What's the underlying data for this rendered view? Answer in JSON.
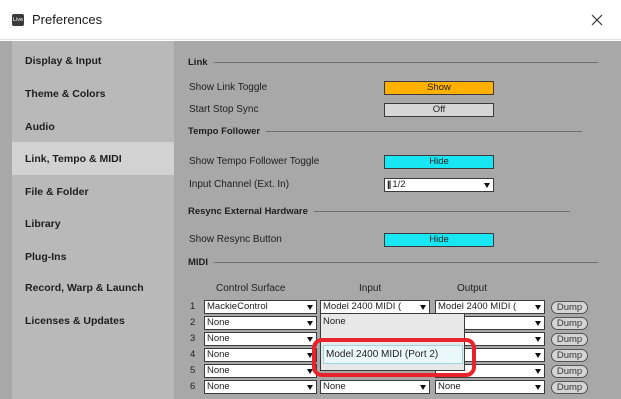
{
  "window": {
    "app_icon_text": "Live",
    "title": "Preferences"
  },
  "sidebar": {
    "items": [
      {
        "label": "Display & Input",
        "active": false
      },
      {
        "label": "Theme & Colors",
        "active": false
      },
      {
        "label": "Audio",
        "active": false
      },
      {
        "label": "Link, Tempo & MIDI",
        "active": true
      },
      {
        "label": "File & Folder",
        "active": false
      },
      {
        "label": "Library",
        "active": false
      },
      {
        "label": "Plug-Ins",
        "active": false
      },
      {
        "label": "Record, Warp & Launch",
        "active": false
      },
      {
        "label": "Licenses & Updates",
        "active": false
      }
    ]
  },
  "link": {
    "section": "Link",
    "show_toggle_label": "Show Link Toggle",
    "show_toggle_value": "Show",
    "start_stop_label": "Start Stop Sync",
    "start_stop_value": "Off"
  },
  "tempo_follower": {
    "section": "Tempo Follower",
    "show_toggle_label": "Show Tempo Follower Toggle",
    "show_toggle_value": "Hide",
    "input_channel_label": "Input Channel (Ext. In)",
    "input_channel_value": "1/2"
  },
  "resync": {
    "section": "Resync External Hardware",
    "show_button_label": "Show Resync Button",
    "show_button_value": "Hide"
  },
  "midi": {
    "section": "MIDI",
    "headers": {
      "control_surface": "Control Surface",
      "input": "Input",
      "output": "Output"
    },
    "dump_label": "Dump",
    "rows": [
      {
        "num": "1",
        "surface": "MackieControl",
        "input": "Model 2400 MIDI (",
        "output": "Model 2400 MIDI ("
      },
      {
        "num": "2",
        "surface": "None",
        "input": "",
        "output": ""
      },
      {
        "num": "3",
        "surface": "None",
        "input": "",
        "output": ""
      },
      {
        "num": "4",
        "surface": "None",
        "input": "",
        "output": ""
      },
      {
        "num": "5",
        "surface": "None",
        "input": "",
        "output": ""
      },
      {
        "num": "6",
        "surface": "None",
        "input": "None",
        "output": "None"
      }
    ],
    "dropdown": {
      "option_none": "None",
      "highlighted": "Model 2400 MIDI (Port 2)"
    }
  },
  "colors": {
    "show_orange": "#ffb000",
    "hide_cyan": "#18e6f2",
    "callout_red": "#e8232a"
  }
}
